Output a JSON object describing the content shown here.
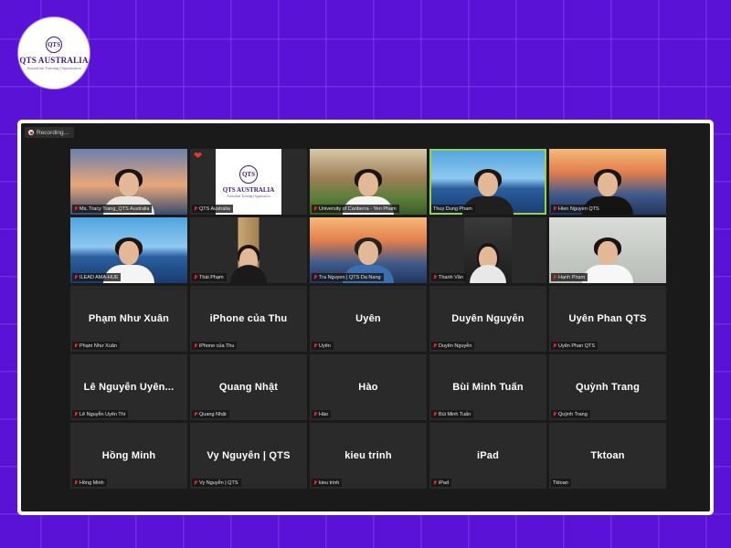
{
  "logo": {
    "name": "QTS AUSTRALIA",
    "subtitle": "Australian Training Organisation",
    "monogram": "QTS"
  },
  "recording": {
    "label": "Recording..."
  },
  "reaction": {
    "icon": "heart-icon",
    "glyph": "❤"
  },
  "tile_logo": {
    "name": "QTS AUSTRALIA",
    "subtitle": "Australian Training Organisation",
    "monogram": "QTS"
  },
  "colors": {
    "page_bg": "#5a12d6",
    "active_speaker": "#9bd14a",
    "muted_mic": "#e02828"
  },
  "participants": [
    {
      "name": "Ms. Tracy Trang_QTS Australia",
      "display": "",
      "video": true,
      "muted": true
    },
    {
      "name": "QTS Australia",
      "display": "",
      "video": true,
      "muted": true
    },
    {
      "name": "University of Canberra - Yen Pham",
      "display": "",
      "video": true,
      "muted": true
    },
    {
      "name": "Thuy Dung Pham",
      "display": "",
      "video": true,
      "muted": false,
      "active": true
    },
    {
      "name": "Hien Nguyen QTS",
      "display": "",
      "video": true,
      "muted": true
    },
    {
      "name": "ILEAD AMA-HUE",
      "display": "",
      "video": true,
      "muted": true
    },
    {
      "name": "Thái Phạm",
      "display": "",
      "video": true,
      "muted": true
    },
    {
      "name": "Tra Nguyen | QTS Da Nang",
      "display": "",
      "video": true,
      "muted": true
    },
    {
      "name": "Thanh Vân",
      "display": "",
      "video": true,
      "muted": true
    },
    {
      "name": "Hạnh Phạm",
      "display": "",
      "video": true,
      "muted": true
    },
    {
      "name": "Phạm Như Xuân",
      "display": "Phạm Như Xuân",
      "video": false,
      "muted": true
    },
    {
      "name": "iPhone của Thu",
      "display": "iPhone của Thu",
      "video": false,
      "muted": true
    },
    {
      "name": "Uyên",
      "display": "Uyên",
      "video": false,
      "muted": true
    },
    {
      "name": "Duyên Nguyễn",
      "display": "Duyên Nguyễn",
      "video": false,
      "muted": true
    },
    {
      "name": "Uyên Phan QTS",
      "display": "Uyên Phan QTS",
      "video": false,
      "muted": true
    },
    {
      "name": "Lê Nguyễn Uyên Thi",
      "display": "Lê Nguyễn Uyên...",
      "video": false,
      "muted": true
    },
    {
      "name": "Quang Nhật",
      "display": "Quang Nhật",
      "video": false,
      "muted": true
    },
    {
      "name": "Hào",
      "display": "Hào",
      "video": false,
      "muted": true
    },
    {
      "name": "Bùi Minh Tuấn",
      "display": "Bùi Minh Tuấn",
      "video": false,
      "muted": true
    },
    {
      "name": "Quỳnh Trang",
      "display": "Quỳnh Trang",
      "video": false,
      "muted": true
    },
    {
      "name": "Hồng Minh",
      "display": "Hồng Minh",
      "video": false,
      "muted": true
    },
    {
      "name": "Vy Nguyễn | QTS",
      "display": "Vy Nguyễn | QTS",
      "video": false,
      "muted": true
    },
    {
      "name": "kieu trinh",
      "display": "kieu trinh",
      "video": false,
      "muted": true
    },
    {
      "name": "iPad",
      "display": "iPad",
      "video": false,
      "muted": true
    },
    {
      "name": "Tktoan",
      "display": "Tktoan",
      "video": false,
      "muted": false
    }
  ]
}
